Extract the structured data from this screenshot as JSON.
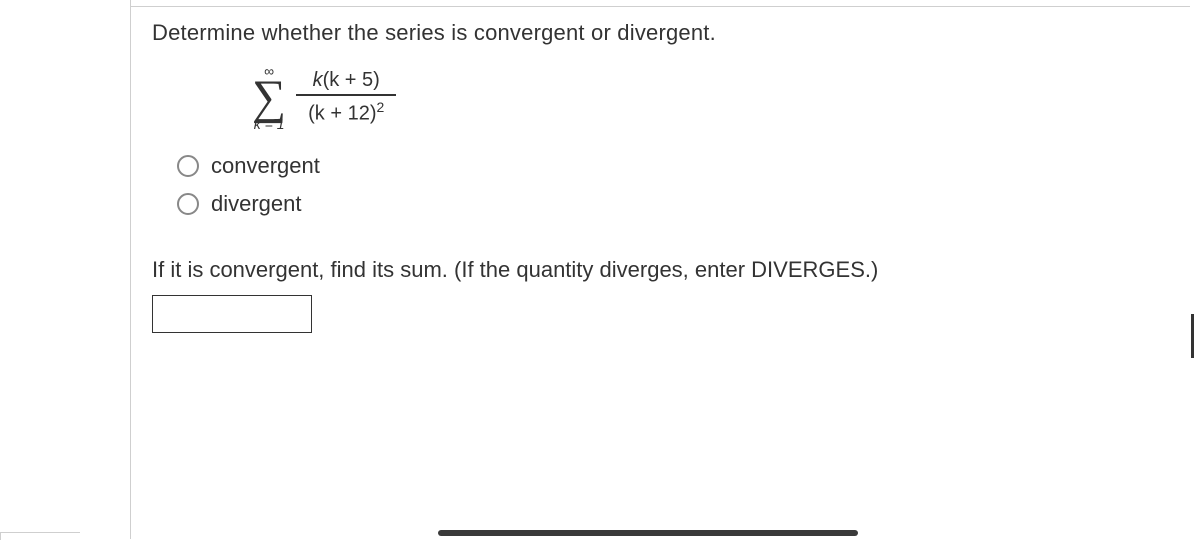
{
  "question": "Determine whether the series is convergent or divergent.",
  "series": {
    "upper": "∞",
    "lower": "k = 1",
    "numerator_var": "k",
    "numerator_rest": "(k + 5)",
    "denominator_base": "(k + 12)",
    "denominator_exp": "2"
  },
  "options": [
    {
      "label": "convergent"
    },
    {
      "label": "divergent"
    }
  ],
  "part2": "If it is convergent, find its sum. (If the quantity diverges, enter DIVERGES.)",
  "answer_value": ""
}
